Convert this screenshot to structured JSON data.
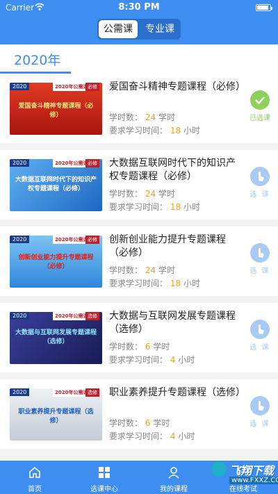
{
  "status": {
    "carrier": "Carrier",
    "time": "8:30 PM"
  },
  "segment": {
    "tab1": "公需课",
    "tab2": "专业课",
    "active": "公需课"
  },
  "year": "2020年",
  "labels": {
    "hours": "学时数：",
    "hours_unit": "学时",
    "required": "要求学习时间：",
    "required_unit": "小时"
  },
  "courses": [
    {
      "title": "爱国奋斗精神专题课程（必修）",
      "hours": "24",
      "required": "18",
      "status": "已选课",
      "thumb_year": "2020",
      "thumb_cat": "2020年公需课",
      "thumb_type": "必修",
      "thumb_text": "爱国奋斗精神专题课程（必修）",
      "thumb_bg": "#c8201e"
    },
    {
      "title": "大数据互联网时代下的知识产权专题课程（必修）",
      "hours": "24",
      "required": "18",
      "status": "选 课",
      "thumb_year": "2020",
      "thumb_cat": "2020年公需课",
      "thumb_type": "必修",
      "thumb_text": "大数据互联网时代下的知识产权专题课程（必修）",
      "thumb_bg": "#2f7fd6"
    },
    {
      "title": "创新创业能力提升专题课程（必修）",
      "hours": "24",
      "required": "18",
      "status": "选 课",
      "thumb_year": "2020",
      "thumb_cat": "2020年公需课",
      "thumb_type": "必修",
      "thumb_text": "创新创业能力提升专题课程（必修）",
      "thumb_bg": "#3a9be8"
    },
    {
      "title": "大数据与互联网发展专题课程（选修）",
      "hours": "6",
      "required": "4",
      "status": "选 课",
      "thumb_year": "2020",
      "thumb_cat": "2020年公需课",
      "thumb_type": "选修",
      "thumb_text": "大数据与互联网发展专题课程（选修）",
      "thumb_bg": "#2a2f7a"
    },
    {
      "title": "职业素养提升专题课程（选修）",
      "hours": "6",
      "required": "4",
      "status": "选 课",
      "thumb_year": "2020",
      "thumb_cat": "2020年公需课",
      "thumb_type": "选修",
      "thumb_text": "职业素养提升专题课程（选修）",
      "thumb_bg": "#d9dee6"
    }
  ],
  "tabbar": [
    {
      "label": "首页",
      "icon": "home-icon"
    },
    {
      "label": "选课中心",
      "icon": "grid-icon"
    },
    {
      "label": "我的课程",
      "icon": "user-icon"
    },
    {
      "label": "在线考试",
      "icon": "exam-icon"
    }
  ],
  "watermark": {
    "text": "飞翔下载",
    "url": "www.FXXZ.COM"
  },
  "colors": {
    "primary": "#3d8ef0",
    "orange": "#f0a020",
    "done": "#8fcf5b",
    "todo": "#a9cbf3"
  }
}
